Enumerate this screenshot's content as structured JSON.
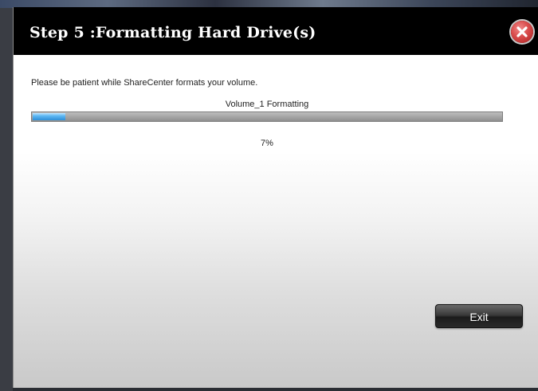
{
  "dialog": {
    "title": "Step 5 :Formatting Hard Drive(s)",
    "message": "Please be patient while ShareCenter formats your volume.",
    "volume_status": "Volume_1 Formatting",
    "progress": 0.07,
    "percent_text": "7%",
    "exit_label": "Exit",
    "close_icon": "close-icon"
  },
  "colors": {
    "title_bar": "#000000",
    "progress_fill": "#3b9be0",
    "close_button": "#d84a4a"
  }
}
